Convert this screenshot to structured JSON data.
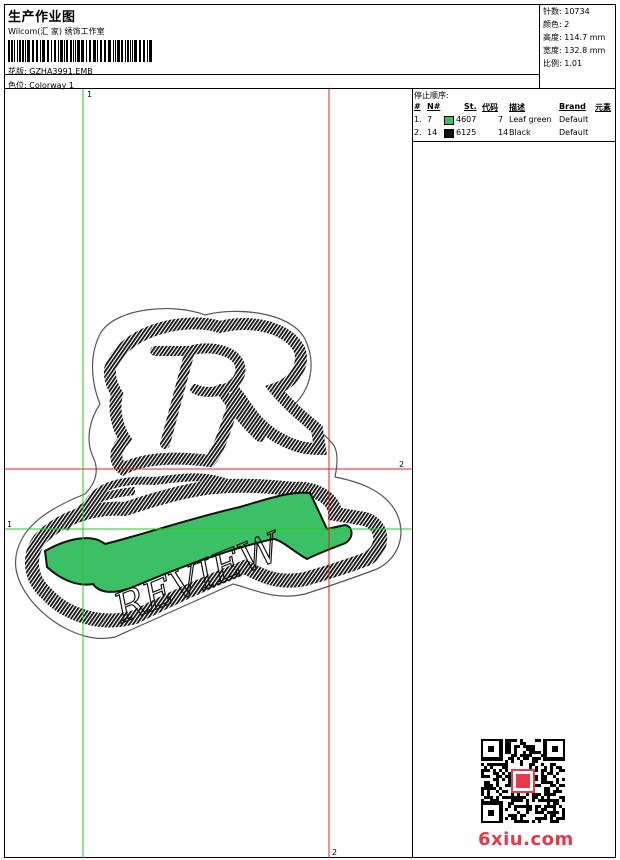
{
  "header": {
    "title": "生产作业图",
    "studio": "Wilcom(汇 家) 绣饰工作室",
    "pattern_label": "花版:",
    "pattern_value": "GZHA3991.EMB",
    "colorway_label": "色位:",
    "colorway_value": "Colorway 1"
  },
  "info": {
    "stitches_label": "针数:",
    "stitches": "10734",
    "colors_label": "颜色:",
    "colors": "2",
    "height_label": "高度:",
    "height": "114.7 mm",
    "width_label": "宽度:",
    "width": "132.8 mm",
    "scale_label": "比例:",
    "scale": "1.01"
  },
  "stop_sequence": {
    "title": "停止顺序:",
    "headers": {
      "num": "#",
      "n": "N#",
      "st": "St.",
      "code": "代码",
      "desc": "描述",
      "brand": "Brand",
      "element": "元素"
    },
    "rows": [
      {
        "num": "1.",
        "n": "7",
        "color": "#3cc065",
        "st": "4607",
        "code": "7",
        "desc": "Leaf green",
        "brand": "Default"
      },
      {
        "num": "2.",
        "n": "14",
        "color": "#111111",
        "st": "6125",
        "code": "14",
        "desc": "Black",
        "brand": "Default"
      }
    ]
  },
  "guides": {
    "green_v": "1",
    "green_h": "1",
    "red_v": "2",
    "red_h": "2"
  },
  "design": {
    "word": "REVIEW"
  },
  "watermark": "6xiu.com",
  "colors": {
    "leaf_green": "#3cc065",
    "black": "#111111",
    "guide_green": "#22cc22",
    "guide_red": "#dd2222",
    "brand_red": "#e8384b"
  }
}
